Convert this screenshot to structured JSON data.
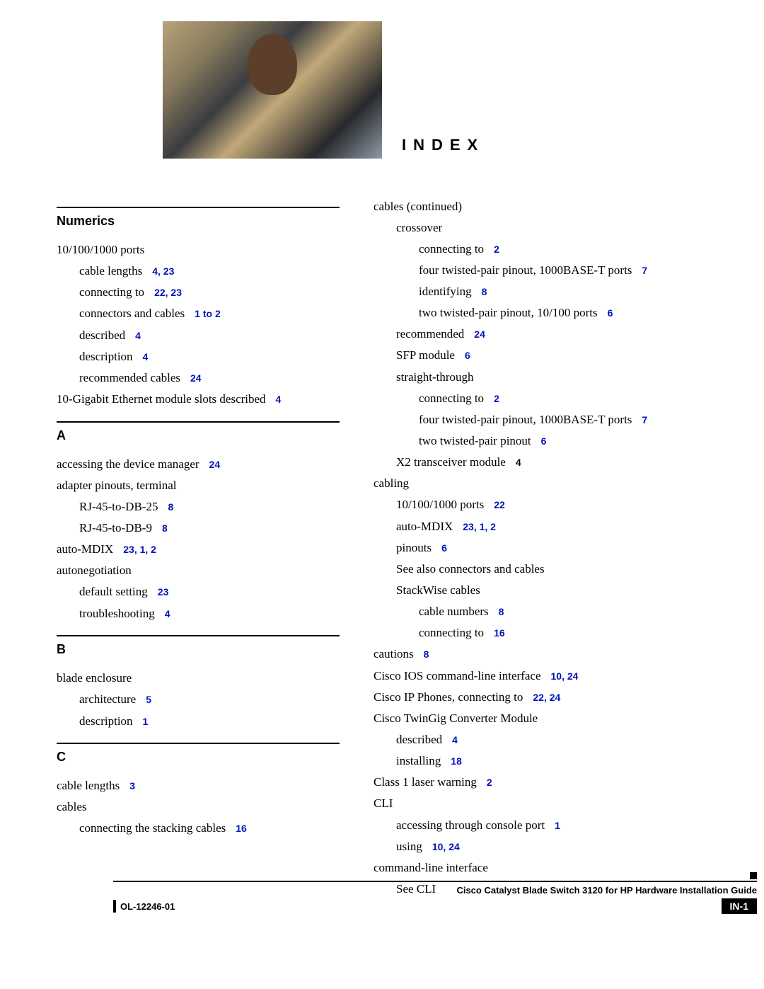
{
  "title": "INDEX",
  "left": {
    "numerics": {
      "head": "Numerics",
      "r1": "10/100/1000 ports",
      "r2": "cable lengths",
      "r2p": "4, 23",
      "r3": "connecting to",
      "r3p": "22, 23",
      "r4": "connectors and cables",
      "r4p": "1 to 2",
      "r5": "described",
      "r5p": "4",
      "r6": "description",
      "r6p": "4",
      "r7": "recommended cables",
      "r7p": "24",
      "r8": "10-Gigabit Ethernet module slots described",
      "r8p": "4"
    },
    "a": {
      "head": "A",
      "r1": "accessing the device manager",
      "r1p": "24",
      "r2": "adapter pinouts, terminal",
      "r3": "RJ-45-to-DB-25",
      "r3p": "8",
      "r4": "RJ-45-to-DB-9",
      "r4p": "8",
      "r5": "auto-MDIX",
      "r5p": "23, 1, 2",
      "r6": "autonegotiation",
      "r7": "default setting",
      "r7p": "23",
      "r8": "troubleshooting",
      "r8p": "4"
    },
    "b": {
      "head": "B",
      "r1": "blade enclosure",
      "r2": "architecture",
      "r2p": "5",
      "r3": "description",
      "r3p": "1"
    },
    "c": {
      "head": "C",
      "r1": "cable lengths",
      "r1p": "3",
      "r2": "cables",
      "r3": "connecting the stacking cables",
      "r3p": "16"
    }
  },
  "right": {
    "r1": "cables (continued)",
    "r2": "crossover",
    "r3": "connecting to",
    "r3p": "2",
    "r4": "four twisted-pair pinout, 1000BASE-T ports",
    "r4p": "7",
    "r5": "identifying",
    "r5p": "8",
    "r6": "two twisted-pair pinout, 10/100 ports",
    "r6p": "6",
    "r7": "recommended",
    "r7p": "24",
    "r8": "SFP module",
    "r8p": "6",
    "r9": "straight-through",
    "r10": "connecting to",
    "r10p": "2",
    "r11": "four twisted-pair pinout, 1000BASE-T ports",
    "r11p": "7",
    "r12": "two twisted-pair pinout",
    "r12p": "6",
    "r13": "X2 transceiver module",
    "r13p": "4",
    "r14": "cabling",
    "r15": "10/100/1000 ports",
    "r15p": "22",
    "r16": "auto-MDIX",
    "r16p": "23, 1, 2",
    "r17": "pinouts",
    "r17p": "6",
    "r18": "See also connectors and cables",
    "r19": "StackWise cables",
    "r20": "cable numbers",
    "r20p": "8",
    "r21": "connecting to",
    "r21p": "16",
    "r22": "cautions",
    "r22p": "8",
    "r23": "Cisco IOS command-line interface",
    "r23p": "10, 24",
    "r24": "Cisco IP Phones, connecting to",
    "r24p": "22, 24",
    "r25": "Cisco TwinGig Converter Module",
    "r26": "described",
    "r26p": "4",
    "r27": "installing",
    "r27p": "18",
    "r28": "Class 1 laser warning",
    "r28p": "2",
    "r29": "CLI",
    "r30": "accessing through console port",
    "r30p": "1",
    "r31": "using",
    "r31p": "10, 24",
    "r32": "command-line interface",
    "r33": "See CLI"
  },
  "footer": {
    "guide": "Cisco Catalyst Blade Switch 3120 for HP Hardware Installation Guide",
    "docnum": "OL-12246-01",
    "page": "IN-1"
  }
}
